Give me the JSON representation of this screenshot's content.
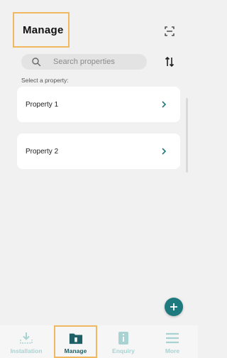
{
  "header": {
    "title": "Manage"
  },
  "search": {
    "placeholder": "Search properties",
    "value": ""
  },
  "select_label": "Select a property:",
  "properties": [
    {
      "label": "Property 1"
    },
    {
      "label": "Property 2"
    }
  ],
  "bottom_nav": {
    "items": [
      {
        "label": "Installation",
        "icon": "download-icon",
        "active": false
      },
      {
        "label": "Manage",
        "icon": "folder-icon",
        "active": true
      },
      {
        "label": "Enquiry",
        "icon": "info-icon",
        "active": false
      },
      {
        "label": "More",
        "icon": "menu-icon",
        "active": false
      }
    ]
  },
  "colors": {
    "accent": "#1e7a7f",
    "active_nav": "#1e5f66",
    "inactive_nav": "#a9d3d3",
    "highlight_border": "#f0b860",
    "background": "#f1f1f1"
  }
}
